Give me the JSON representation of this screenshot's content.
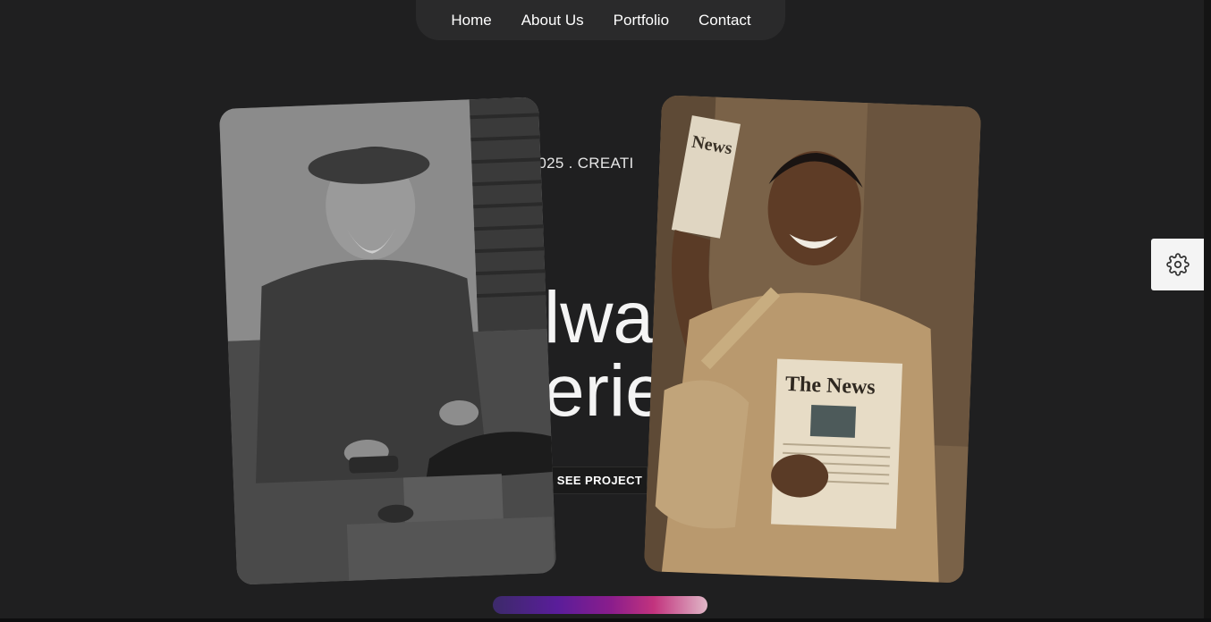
{
  "nav": {
    "items": [
      {
        "label": "Home"
      },
      {
        "label": "About Us"
      },
      {
        "label": "Portfolio"
      },
      {
        "label": "Contact"
      }
    ]
  },
  "hero": {
    "tagline_visible": "C 2025 . CREATI",
    "headline_line1_visible": "lwa",
    "headline_line2_visible": "erie",
    "cta_label": "SEE PROJECT"
  },
  "cards": [
    {
      "name": "shoe shiner portrait",
      "tone": "monochrome"
    },
    {
      "name": "newspaper seller portrait",
      "tone": "sepia",
      "newspaper_text_top": "News",
      "newspaper_text_main": "The News"
    }
  ],
  "settings": {
    "icon": "gear-icon"
  },
  "slider": {
    "progress": 1.0,
    "gradient_colors": [
      "#3c2a6a",
      "#5a1d9a",
      "#c2337e",
      "#e0b7c7"
    ]
  },
  "colors": {
    "background": "#1f1f20",
    "nav_bg": "#2a2a2b",
    "text": "#ffffff"
  }
}
